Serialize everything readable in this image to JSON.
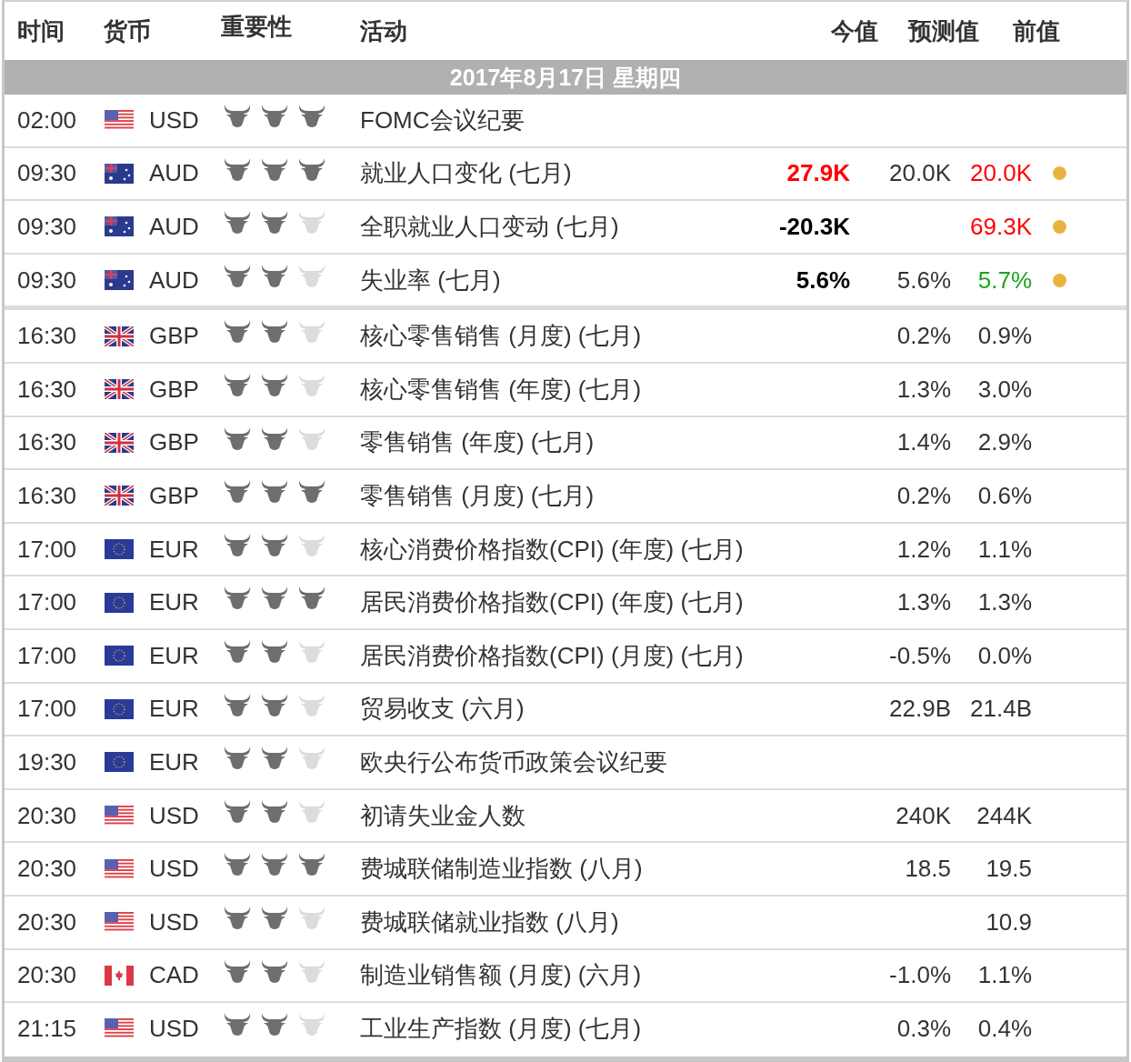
{
  "columns": [
    "时间",
    "货币",
    "重要性",
    "活动",
    "今值",
    "预测值",
    "前值"
  ],
  "date_bar": "2017年8月17日  星期四",
  "groups": [
    {
      "rows": [
        {
          "time": "02:00",
          "kind": "us",
          "currency": "USD",
          "stars": 3,
          "event": "FOMC会议纪要",
          "alert": false
        },
        {
          "time": "09:30",
          "kind": "au",
          "currency": "AUD",
          "stars": 3,
          "event": "就业人口变化 (七月)",
          "actual": {
            "text": "27.9K",
            "color": "#ff0000"
          },
          "forecast": "20.0K",
          "previous": {
            "text": "20.0K",
            "color": "#ff0000"
          },
          "alert": true
        },
        {
          "time": "09:30",
          "kind": "au",
          "currency": "AUD",
          "stars": 2,
          "event": "全职就业人口变动 (七月)",
          "actual": {
            "text": "-20.3K",
            "color": "#000000"
          },
          "previous": {
            "text": "69.3K",
            "color": "#ff0000"
          },
          "alert": true
        },
        {
          "time": "09:30",
          "kind": "au",
          "currency": "AUD",
          "stars": 2,
          "event": "失业率 (七月)",
          "actual": {
            "text": "5.6%",
            "color": "#000000"
          },
          "forecast": "5.6%",
          "previous": {
            "text": "5.7%",
            "color": "#1aa51a"
          },
          "alert": true
        }
      ]
    },
    {
      "rows": [
        {
          "time": "16:30",
          "kind": "gb",
          "currency": "GBP",
          "stars": 2,
          "event": "核心零售销售 (月度) (七月)",
          "forecast": "0.2%",
          "previous": {
            "text": "0.9%"
          },
          "alert": false
        },
        {
          "time": "16:30",
          "kind": "gb",
          "currency": "GBP",
          "stars": 2,
          "event": "核心零售销售 (年度) (七月)",
          "forecast": "1.3%",
          "previous": {
            "text": "3.0%"
          },
          "alert": false
        },
        {
          "time": "16:30",
          "kind": "gb",
          "currency": "GBP",
          "stars": 2,
          "event": "零售销售 (年度) (七月)",
          "forecast": "1.4%",
          "previous": {
            "text": "2.9%"
          },
          "alert": false
        },
        {
          "time": "16:30",
          "kind": "gb",
          "currency": "GBP",
          "stars": 3,
          "event": "零售销售 (月度) (七月)",
          "forecast": "0.2%",
          "previous": {
            "text": "0.6%"
          },
          "alert": false
        },
        {
          "time": "17:00",
          "kind": "eu",
          "currency": "EUR",
          "stars": 2,
          "event": "核心消费价格指数(CPI) (年度) (七月)",
          "forecast": "1.2%",
          "previous": {
            "text": "1.1%"
          },
          "alert": false
        },
        {
          "time": "17:00",
          "kind": "eu",
          "currency": "EUR",
          "stars": 3,
          "event": "居民消费价格指数(CPI) (年度) (七月)",
          "forecast": "1.3%",
          "previous": {
            "text": "1.3%"
          },
          "alert": false
        },
        {
          "time": "17:00",
          "kind": "eu",
          "currency": "EUR",
          "stars": 2,
          "event": "居民消费价格指数(CPI) (月度) (七月)",
          "forecast": "-0.5%",
          "previous": {
            "text": "0.0%"
          },
          "alert": false
        },
        {
          "time": "17:00",
          "kind": "eu",
          "currency": "EUR",
          "stars": 2,
          "event": "贸易收支 (六月)",
          "forecast": "22.9B",
          "previous": {
            "text": "21.4B"
          },
          "alert": false
        },
        {
          "time": "19:30",
          "kind": "eu",
          "currency": "EUR",
          "stars": 2,
          "event": "欧央行公布货币政策会议纪要",
          "alert": false
        },
        {
          "time": "20:30",
          "kind": "us",
          "currency": "USD",
          "stars": 2,
          "event": "初请失业金人数",
          "forecast": "240K",
          "previous": {
            "text": "244K"
          },
          "alert": false
        },
        {
          "time": "20:30",
          "kind": "us",
          "currency": "USD",
          "stars": 3,
          "event": "费城联储制造业指数 (八月)",
          "forecast": "18.5",
          "previous": {
            "text": "19.5"
          },
          "alert": false
        },
        {
          "time": "20:30",
          "kind": "us",
          "currency": "USD",
          "stars": 2,
          "event": "费城联储就业指数 (八月)",
          "previous": {
            "text": "10.9"
          },
          "alert": false
        },
        {
          "time": "20:30",
          "kind": "ca",
          "currency": "CAD",
          "stars": 2,
          "event": "制造业销售额 (月度) (六月)",
          "forecast": "-1.0%",
          "previous": {
            "text": "1.1%"
          },
          "alert": false
        },
        {
          "time": "21:15",
          "kind": "us",
          "currency": "USD",
          "stars": 2,
          "event": "工业生产指数 (月度) (七月)",
          "forecast": "0.3%",
          "previous": {
            "text": "0.4%"
          },
          "alert": false
        }
      ]
    }
  ]
}
